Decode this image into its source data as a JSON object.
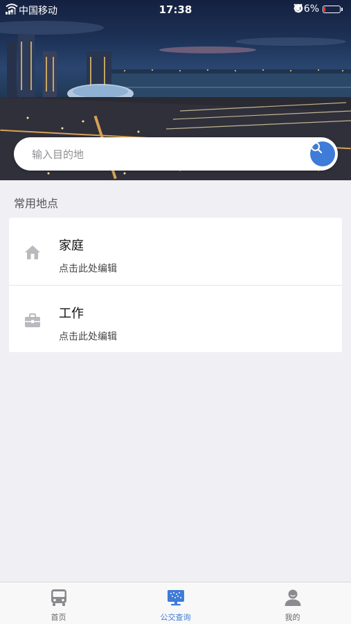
{
  "status_bar": {
    "carrier": "中国移动",
    "time": "17:38",
    "battery_percent": "6%",
    "battery_level": 0.06,
    "icons": [
      "signal-icon",
      "wifi-icon",
      "orientation-lock-icon",
      "location-icon",
      "alarm-icon",
      "battery-icon",
      "charging-icon"
    ]
  },
  "search": {
    "placeholder": "输入目的地",
    "icon": "search-icon"
  },
  "frequent": {
    "title": "常用地点",
    "items": [
      {
        "name": "家庭",
        "hint": "点击此处编辑",
        "icon": "home-icon"
      },
      {
        "name": "工作",
        "hint": "点击此处编辑",
        "icon": "briefcase-icon"
      }
    ]
  },
  "tabbar": {
    "active_color": "#3f7bd8",
    "tabs": [
      {
        "label": "首页",
        "icon": "bus-icon",
        "active": false
      },
      {
        "label": "公交查询",
        "icon": "monitor-icon",
        "active": true
      },
      {
        "label": "我的",
        "icon": "user-icon",
        "active": false
      }
    ]
  }
}
